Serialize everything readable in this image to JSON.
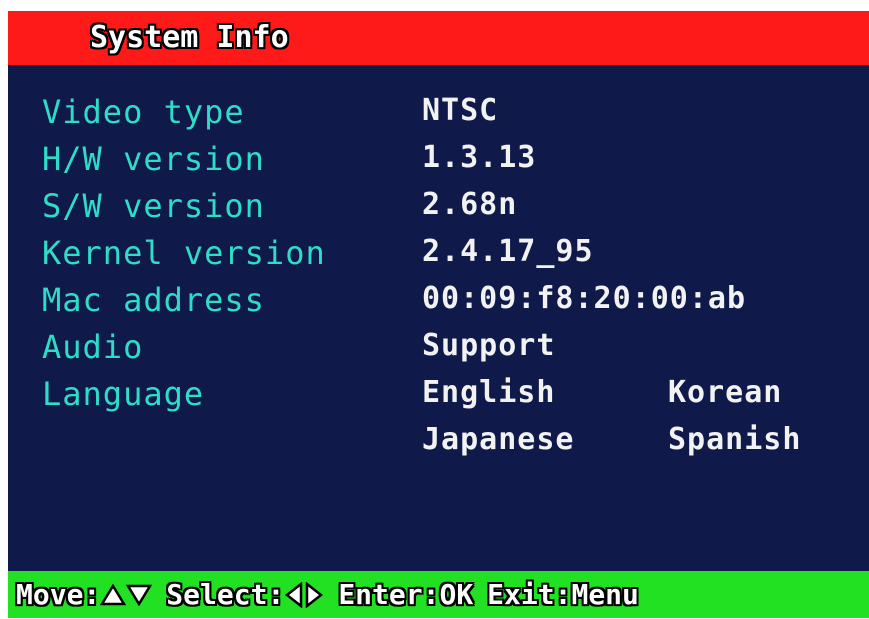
{
  "title": "System Info",
  "rows": [
    {
      "label": "Video type",
      "value": "NTSC"
    },
    {
      "label": "H/W version",
      "value": "1.3.13"
    },
    {
      "label": "S/W version",
      "value": "2.68n"
    },
    {
      "label": "Kernel version",
      "value": "2.4.17_95"
    },
    {
      "label": "Mac address",
      "value": "00:09:f8:20:00:ab"
    },
    {
      "label": "Audio",
      "value": "Support"
    },
    {
      "label": "Language",
      "options": [
        "English",
        "Korean",
        "Japanese",
        "Spanish"
      ]
    }
  ],
  "footer": {
    "move_label": "Move:",
    "move_icons": [
      "up-triangle-icon",
      "down-triangle-icon"
    ],
    "select_label": "Select:",
    "select_icons": [
      "left-triangle-icon",
      "right-triangle-icon"
    ],
    "enter_label": "Enter:OK",
    "exit_label": "Exit:Menu"
  },
  "colors": {
    "background": "#101a4a",
    "title_bar": "#ff1a1a",
    "footer_bar": "#22e022",
    "label_text": "#2fdcc8",
    "value_text": "#f2f2f2"
  }
}
